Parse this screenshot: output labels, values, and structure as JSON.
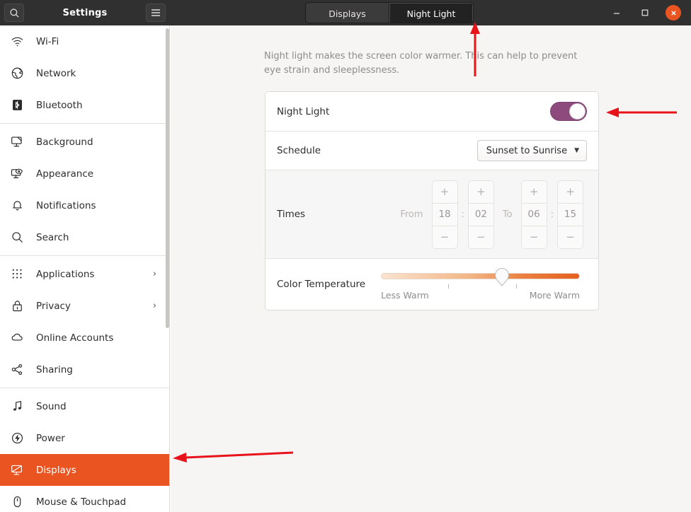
{
  "window": {
    "title": "Settings",
    "search_icon": "search-icon",
    "menu_icon": "hamburger-menu-icon",
    "controls": {
      "minimize": "–",
      "maximize": "□",
      "close": "✕"
    }
  },
  "tabs": [
    {
      "label": "Displays",
      "active": false
    },
    {
      "label": "Night Light",
      "active": true
    }
  ],
  "sidebar": {
    "groups": [
      {
        "items": [
          {
            "label": "Wi-Fi",
            "icon": "wifi-icon",
            "chevron": "",
            "selected": false
          },
          {
            "label": "Network",
            "icon": "network-globe-icon",
            "chevron": "",
            "selected": false
          },
          {
            "label": "Bluetooth",
            "icon": "bluetooth-icon",
            "chevron": "",
            "selected": false
          }
        ]
      },
      {
        "items": [
          {
            "label": "Background",
            "icon": "background-icon",
            "chevron": "",
            "selected": false
          },
          {
            "label": "Appearance",
            "icon": "appearance-icon",
            "chevron": "",
            "selected": false
          },
          {
            "label": "Notifications",
            "icon": "bell-icon",
            "chevron": "",
            "selected": false
          },
          {
            "label": "Search",
            "icon": "search-icon",
            "chevron": "",
            "selected": false
          }
        ]
      },
      {
        "items": [
          {
            "label": "Applications",
            "icon": "grid-apps-icon",
            "chevron": "›",
            "selected": false
          },
          {
            "label": "Privacy",
            "icon": "lock-icon",
            "chevron": "›",
            "selected": false
          },
          {
            "label": "Online Accounts",
            "icon": "cloud-icon",
            "chevron": "",
            "selected": false
          },
          {
            "label": "Sharing",
            "icon": "share-nodes-icon",
            "chevron": "",
            "selected": false
          }
        ]
      },
      {
        "items": [
          {
            "label": "Sound",
            "icon": "music-note-icon",
            "chevron": "",
            "selected": false
          },
          {
            "label": "Power",
            "icon": "power-bolt-icon",
            "chevron": "",
            "selected": false
          },
          {
            "label": "Displays",
            "icon": "display-monitor-icon",
            "chevron": "",
            "selected": true
          },
          {
            "label": "Mouse & Touchpad",
            "icon": "mouse-icon",
            "chevron": "",
            "selected": false
          }
        ]
      }
    ]
  },
  "main": {
    "description": "Night light makes the screen color warmer. This can help to prevent eye strain and sleeplessness.",
    "night_light": {
      "label": "Night Light",
      "enabled": true,
      "toggle_color": "#8c4a7d"
    },
    "schedule": {
      "label": "Schedule",
      "value": "Sunset to Sunrise",
      "caret": "▼"
    },
    "times": {
      "label": "Times",
      "from_label": "From",
      "to_label": "To",
      "colon": ":",
      "plus": "+",
      "minus": "−",
      "from_hour": "18",
      "from_minute": "02",
      "to_hour": "06",
      "to_minute": "15",
      "disabled": true
    },
    "color_temperature": {
      "label": "Color Temperature",
      "less_label": "Less Warm",
      "more_label": "More Warm",
      "value_percent": 61,
      "gradient_start": "#fae3cf",
      "gradient_end": "#e5601f"
    }
  },
  "annotations": {
    "color": "#e8131a",
    "arrows": [
      {
        "name": "arrow-to-night-light-tab",
        "direction": "up"
      },
      {
        "name": "arrow-to-night-light-toggle",
        "direction": "left"
      },
      {
        "name": "arrow-to-displays-sidebar-item",
        "direction": "left"
      }
    ]
  }
}
